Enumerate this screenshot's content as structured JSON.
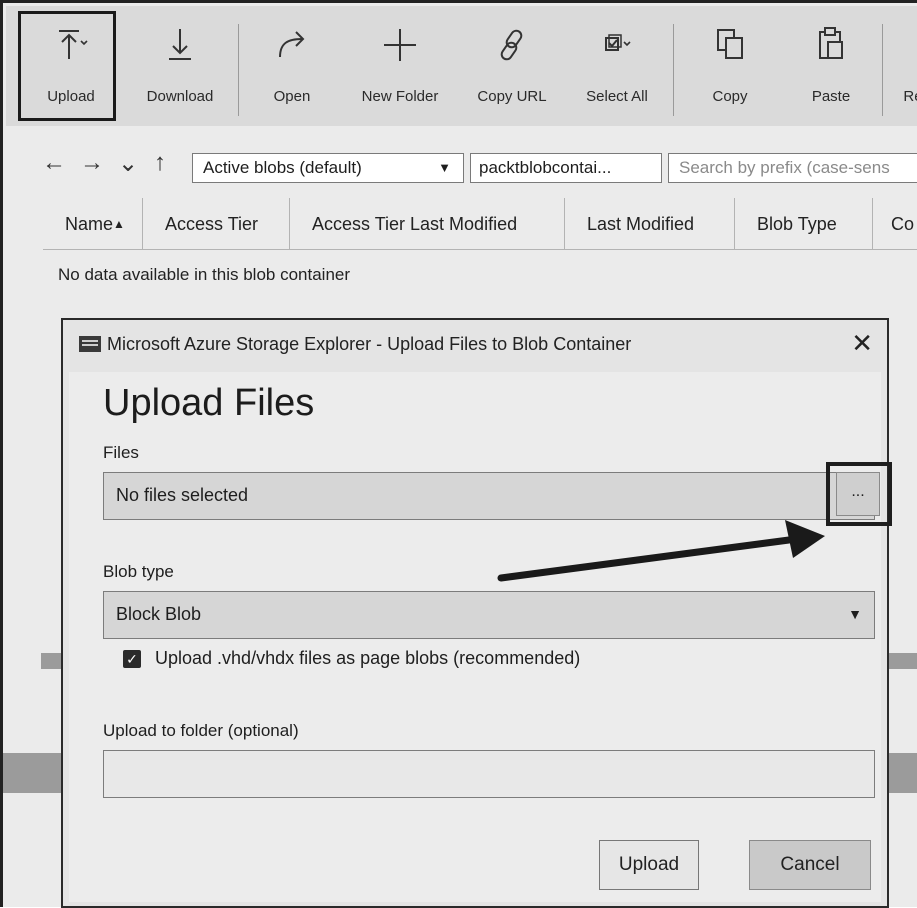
{
  "toolbar": {
    "upload": "Upload",
    "download": "Download",
    "open": "Open",
    "new_folder": "New Folder",
    "copy_url": "Copy URL",
    "select_all": "Select All",
    "copy": "Copy",
    "paste": "Paste",
    "rename_partial": "Re"
  },
  "nav": {
    "view_select": "Active blobs (default)",
    "path": "packtblobcontai...",
    "search_placeholder": "Search by prefix (case-sens"
  },
  "columns": [
    "Name",
    "Access Tier",
    "Access Tier Last Modified",
    "Last Modified",
    "Blob Type",
    "Co"
  ],
  "empty_message": "No data available in this blob container",
  "dialog": {
    "title": "Microsoft Azure Storage Explorer - Upload Files to Blob Container",
    "close_glyph": "✕",
    "heading": "Upload Files",
    "files_label": "Files",
    "files_value": "No files selected",
    "browse_label": "...",
    "blob_type_label": "Blob type",
    "blob_type_value": "Block Blob",
    "page_blob_checkbox_label": "Upload .vhd/vhdx files as page blobs (recommended)",
    "page_blob_checked": true,
    "folder_label": "Upload to folder (optional)",
    "folder_value": "",
    "upload_button": "Upload",
    "cancel_button": "Cancel"
  },
  "colors": {
    "toolbar_bg": "#dadada",
    "page_bg": "#ebebeb",
    "dialog_bg": "#ececec",
    "field_bg": "#d6d6d6",
    "highlight": "#1e1e1e"
  }
}
